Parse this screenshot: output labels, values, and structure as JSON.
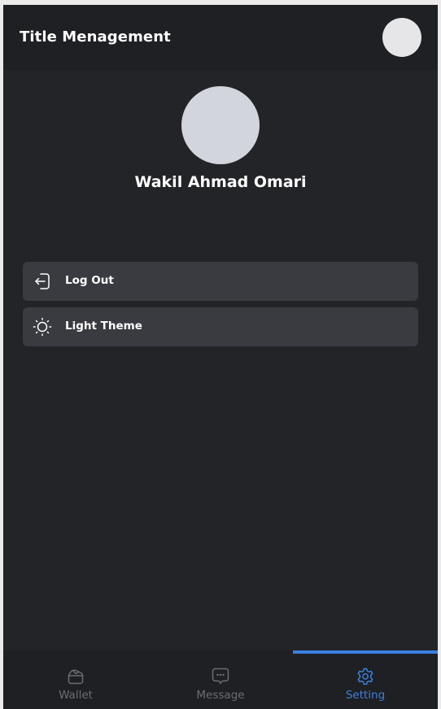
{
  "header": {
    "title": "Title Menagement",
    "avatar_icon": "user-avatar"
  },
  "profile": {
    "name": "Wakil Ahmad Omari",
    "avatar_icon": "profile-avatar"
  },
  "menu": {
    "items": [
      {
        "label": "Log Out",
        "icon": "logout-icon"
      },
      {
        "label": "Light Theme",
        "icon": "sun-icon"
      }
    ]
  },
  "bottom_nav": {
    "items": [
      {
        "label": "Wallet",
        "icon": "wallet-icon",
        "active": false
      },
      {
        "label": "Message",
        "icon": "message-icon",
        "active": false
      },
      {
        "label": "Setting",
        "icon": "gear-icon",
        "active": true
      }
    ]
  },
  "colors": {
    "background": "#232428",
    "header": "#1f2023",
    "card": "#3a3b41",
    "accent": "#3b7fe0",
    "inactive": "#6c6d73",
    "text": "#ffffff"
  }
}
